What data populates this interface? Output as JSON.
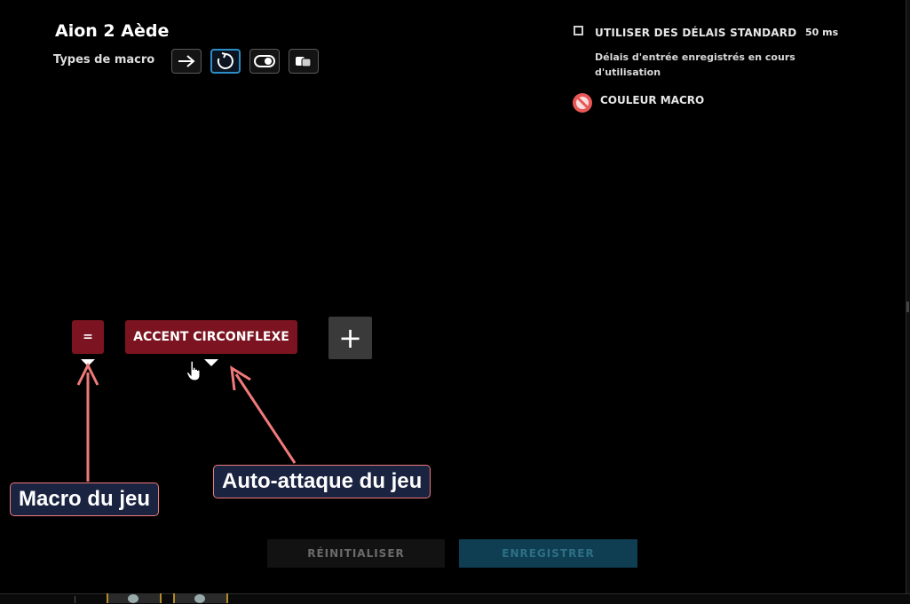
{
  "header": {
    "title": "Aion 2 Aède",
    "macro_types_label": "Types de macro",
    "macro_types": [
      {
        "icon": "arrow-right-icon",
        "active": false
      },
      {
        "icon": "repeat-loop-icon",
        "active": true
      },
      {
        "icon": "toggle-icon",
        "active": false
      },
      {
        "icon": "hold-key-icon",
        "active": false
      }
    ]
  },
  "settings": {
    "use_standard_delays_label": "UTILISER DES DÉLAIS STANDARD",
    "use_standard_delays_checked": false,
    "delay_value": "50 ms",
    "recorded_delays_note": "Délais d'entrée enregistrés en cours d'utilisation",
    "macro_color_label": "COULEUR MACRO",
    "macro_color_icon": "no-color-icon"
  },
  "sequence": {
    "keys": [
      {
        "label": "="
      },
      {
        "label": "ACCENT CIRCONFLEXE"
      }
    ],
    "add_label": "+"
  },
  "annotations": {
    "game_macro": "Macro du jeu",
    "auto_attack": "Auto-attaque du jeu",
    "color": "#f07a7a"
  },
  "footer": {
    "reset_label": "RÉINITIALISER",
    "save_label": "ENREGISTRER"
  },
  "colors": {
    "background": "#000000",
    "key_chip": "#7b1420",
    "accent_blue": "#2b8ec8",
    "save_button": "#0f3e52"
  }
}
